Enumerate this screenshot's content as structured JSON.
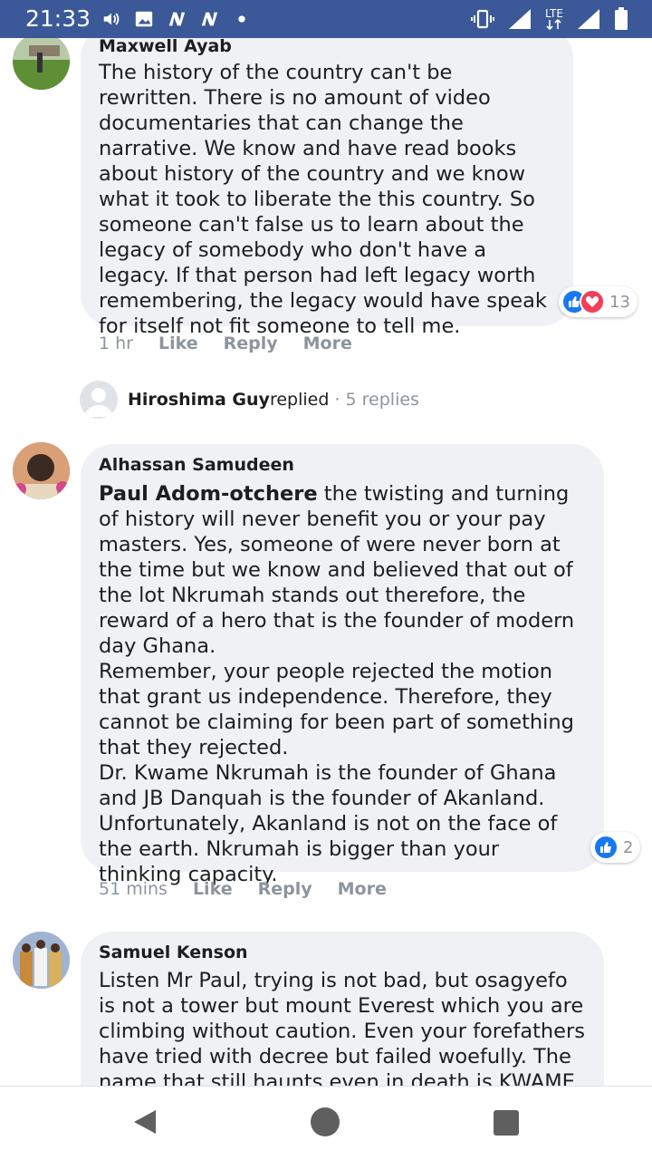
{
  "status_bar": {
    "time": "21:33",
    "network": "LTE",
    "icons": [
      "volume-icon",
      "image-icon",
      "n-notification-icon",
      "n-notification-icon",
      "dot-icon",
      "vibrate-icon",
      "signal-icon",
      "lte-icon",
      "signal-icon",
      "battery-icon"
    ]
  },
  "comments": [
    {
      "author": "Maxwell Ayab",
      "text": "The history of the country can't be rewritten. There is no amount of video documentaries that can change the narrative. We know and have read books about history of the country and we know what it took to liberate the this country. So someone can't false us to learn about the legacy of somebody who don't have a legacy. If that person had left legacy worth remembering, the legacy would have speak for itself not fit someone to tell me.",
      "time": "1 hr",
      "like": "Like",
      "reply": "Reply",
      "more": "More",
      "reaction_count": "13"
    },
    {
      "author": "Alhassan Samudeen",
      "mention": "Paul Adom-otchere",
      "text": " the twisting and turning of history will never benefit you or your pay masters. Yes, someone of were never born at the time but we know and believed that out of the lot Nkrumah stands out therefore, the reward of a hero that is the founder of modern day Ghana.\nRemember, your people rejected the motion that grant us independence. Therefore, they cannot be claiming for been part of something that they rejected.\nDr. Kwame Nkrumah is the founder of Ghana and JB Danquah is the founder of Akanland. Unfortunately, Akanland is not on the face of the earth. Nkrumah is bigger than your thinking capacity.",
      "time": "51 mins",
      "like": "Like",
      "reply": "Reply",
      "more": "More",
      "reaction_count": "2"
    },
    {
      "author": "Samuel Kenson",
      "text": "Listen Mr Paul, trying is not bad, but osagyefo is not a tower but mount Everest which you are climbing without caution. Even your forefathers have tried with decree but failed woefully. The name that still haunts even in death is KWAME"
    }
  ],
  "replies": {
    "name": "Hiroshima Guy",
    "verb": " replied",
    "separator": " · ",
    "count": "5 replies"
  },
  "colors": {
    "status_bar": "#3b5998",
    "bubble": "#eff1f5",
    "like_blue": "#1877f2",
    "love_red": "#f33e58",
    "muted": "#8d949e"
  }
}
